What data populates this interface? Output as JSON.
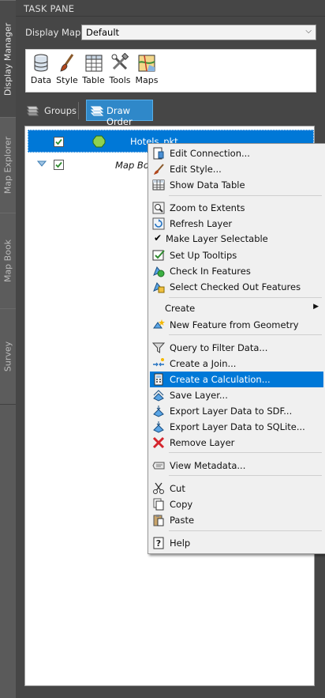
{
  "sidebar": {
    "tabs": [
      {
        "label": "Display Manager",
        "active": true
      },
      {
        "label": "Map Explorer",
        "active": false
      },
      {
        "label": "Map Book",
        "active": false
      },
      {
        "label": "Survey",
        "active": false
      }
    ]
  },
  "pane": {
    "title": "TASK PANE",
    "display_map_label": "Display Map:",
    "display_map_value": "Default"
  },
  "ribbon": {
    "data": "Data",
    "style": "Style",
    "table": "Table",
    "tools": "Tools",
    "maps": "Maps"
  },
  "view_tabs": {
    "groups": "Groups",
    "draw_order": "Draw Order"
  },
  "tree": {
    "layer": "Hotels_pkt",
    "group": "Map Bo"
  },
  "context_menu": {
    "items": [
      {
        "label": "Edit Connection...",
        "icon": "connection-icon"
      },
      {
        "label": "Edit Style...",
        "icon": "brush-icon"
      },
      {
        "label": "Show Data Table",
        "icon": "table-icon"
      },
      {
        "label": "Zoom to Extents",
        "icon": "zoom-extents-icon"
      },
      {
        "label": "Refresh Layer",
        "icon": "refresh-icon"
      },
      {
        "label": "Make Layer Selectable",
        "icon": "checkmark-icon"
      },
      {
        "label": "Set Up Tooltips",
        "icon": "tooltip-icon"
      },
      {
        "label": "Check In Features",
        "icon": "check-in-icon"
      },
      {
        "label": "Select Checked Out Features",
        "icon": "select-checked-out-icon"
      },
      {
        "label": "Create",
        "icon": ""
      },
      {
        "label": "New Feature from Geometry",
        "icon": "new-feature-icon"
      },
      {
        "label": "Query to Filter Data...",
        "icon": "filter-icon"
      },
      {
        "label": "Create a Join...",
        "icon": "join-icon"
      },
      {
        "label": "Create a Calculation...",
        "icon": "calculator-icon"
      },
      {
        "label": "Save Layer...",
        "icon": "save-layer-icon"
      },
      {
        "label": "Export Layer Data to SDF...",
        "icon": "export-sdf-icon"
      },
      {
        "label": "Export Layer Data to SQLite...",
        "icon": "export-sqlite-icon"
      },
      {
        "label": "Remove Layer",
        "icon": "remove-icon"
      },
      {
        "label": "View Metadata...",
        "icon": "metadata-icon"
      },
      {
        "label": "Cut",
        "icon": "cut-icon"
      },
      {
        "label": "Copy",
        "icon": "copy-icon"
      },
      {
        "label": "Paste",
        "icon": "paste-icon"
      },
      {
        "label": "Help",
        "icon": "help-icon"
      }
    ]
  },
  "colors": {
    "highlight": "#0078d7",
    "pane_bg": "#464646",
    "menu_bg": "#f0f0f0"
  }
}
